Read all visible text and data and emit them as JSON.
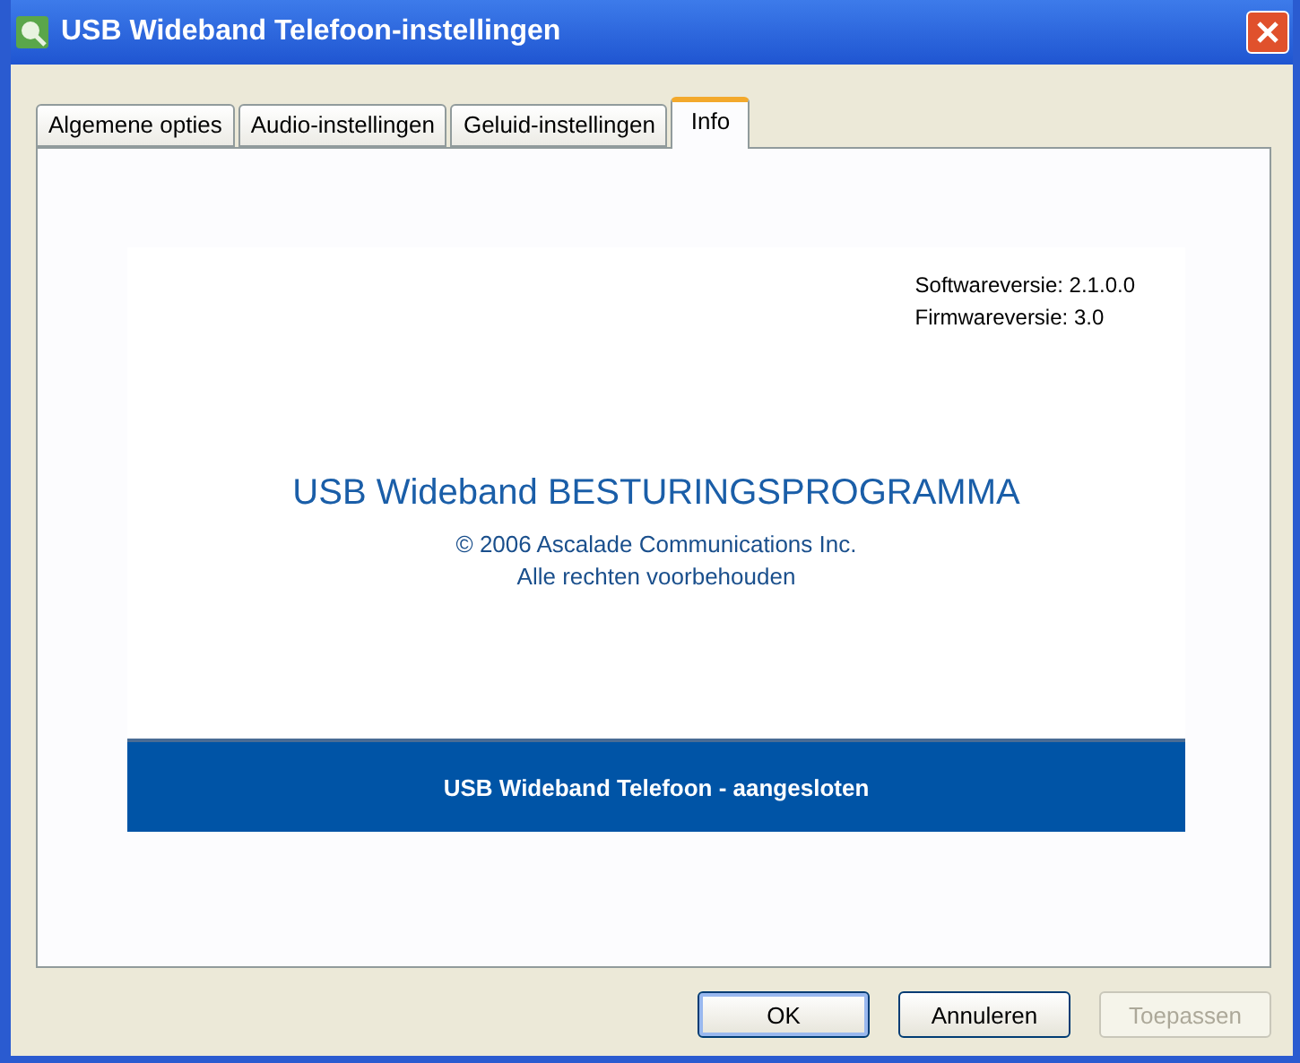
{
  "window": {
    "title": "USB Wideband Telefoon-instellingen"
  },
  "tabs": [
    {
      "label": "Algemene opties",
      "selected": false
    },
    {
      "label": "Audio-instellingen",
      "selected": false
    },
    {
      "label": "Geluid-instellingen",
      "selected": false
    },
    {
      "label": "Info",
      "selected": true
    }
  ],
  "info": {
    "versions": [
      "Softwareversie: 2.1.0.0",
      "Firmwareversie: 3.0"
    ],
    "product": "USB Wideband BESTURINGSPROGRAMMA",
    "copyright": [
      "© 2006 Ascalade Communications Inc.",
      "Alle rechten voorbehouden"
    ],
    "status": "USB Wideband Telefoon - aangesloten"
  },
  "buttons": [
    {
      "label": "OK",
      "disabled": false,
      "default": true
    },
    {
      "label": "Annuleren",
      "disabled": false,
      "default": false
    },
    {
      "label": "Toepassen",
      "disabled": true,
      "default": false
    }
  ]
}
